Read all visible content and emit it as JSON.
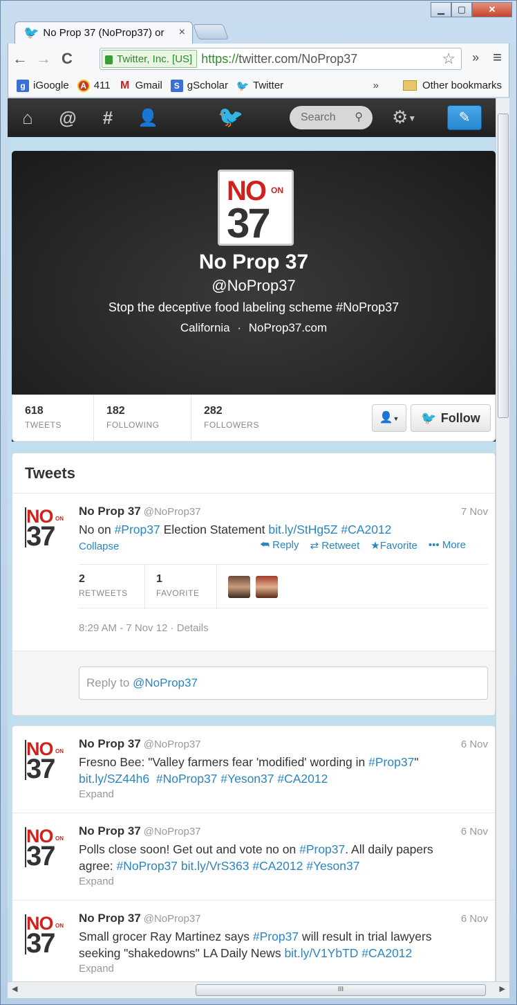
{
  "browser": {
    "tab_title": "No Prop 37 (NoProp37) or",
    "tab_close": "×",
    "window_buttons": {
      "minimize": "▁",
      "maximize": "▢",
      "close": "✕"
    },
    "nav": {
      "back": "←",
      "forward": "→",
      "reload": "C"
    },
    "ev_label": "Twitter, Inc. [US]",
    "url_scheme": "https://",
    "url_rest": "twitter.com/NoProp37",
    "overflow": "»",
    "menu": "≡",
    "bookmarks": [
      {
        "label": "iGoogle",
        "icon": "igoogle-icon",
        "glyph": "g",
        "color": "#3a6fd8"
      },
      {
        "label": "411",
        "icon": "411-icon",
        "glyph": "A",
        "color": "#c0392b"
      },
      {
        "label": "Gmail",
        "icon": "gmail-icon",
        "glyph": "M",
        "color": "#ffffff"
      },
      {
        "label": "gScholar",
        "icon": "gscholar-icon",
        "glyph": "S",
        "color": "#3a6fd8"
      },
      {
        "label": "Twitter",
        "icon": "twitter-bird-icon",
        "glyph": "🐦",
        "color": "#2aa3ef"
      }
    ],
    "bookmarks_more": "»",
    "other_bookmarks": "Other bookmarks"
  },
  "twitter": {
    "search_placeholder": "Search",
    "profile": {
      "logo_no": "NO",
      "logo_on": "ON",
      "logo_37": "37",
      "name": "No Prop 37",
      "handle": "@NoProp37",
      "bio": "Stop the deceptive food labeling scheme #NoProp37",
      "location": "California",
      "separator": "·",
      "website": "NoProp37.com"
    },
    "stats": [
      {
        "num": "618",
        "label": "TWEETS"
      },
      {
        "num": "182",
        "label": "FOLLOWING"
      },
      {
        "num": "282",
        "label": "FOLLOWERS"
      }
    ],
    "follow_label": "Follow",
    "tweets_header": "Tweets",
    "expanded_tweet": {
      "name": "No Prop 37",
      "handle": "@NoProp37",
      "time": "7 Nov",
      "text_plain_1": "No on ",
      "link_1": "#Prop37",
      "text_plain_2": " Election Statement ",
      "link_2": "bit.ly/StHg5Z",
      "link_3": "#CA2012",
      "collapse": "Collapse",
      "actions": {
        "reply": "Reply",
        "retweet": "Retweet",
        "favorite": "Favorite",
        "more": "More"
      },
      "retweets_num": "2",
      "retweets_label": "RETWEETS",
      "favorites_num": "1",
      "favorites_label": "FAVORITE",
      "timestamp": "8:29 AM - 7 Nov 12",
      "details": "Details",
      "reply_prefix": "Reply to ",
      "reply_handle": "@NoProp37"
    },
    "tweets": [
      {
        "name": "No Prop 37",
        "handle": "@NoProp37",
        "time": "6 Nov",
        "line1_plain": "Fresno Bee: \"Valley farmers fear 'modified' wording in ",
        "line1_link": "#Prop37",
        "line1_end": "\"",
        "line2": [
          "bit.ly/SZ44h6",
          "#NoProp37",
          "#Yeson37",
          "#CA2012"
        ],
        "expand": "Expand"
      },
      {
        "name": "No Prop 37",
        "handle": "@NoProp37",
        "time": "6 Nov",
        "line1_plain": "Polls close soon! Get out and vote no on ",
        "line1_link": "#Prop37",
        "line1_end": ". All daily papers",
        "line2_plain": "agree: ",
        "line2": [
          "#NoProp37",
          "bit.ly/VrS363",
          "#CA2012",
          "#Yeson37"
        ],
        "expand": "Expand"
      },
      {
        "name": "No Prop 37",
        "handle": "@NoProp37",
        "time": "6 Nov",
        "line1_plain": "Small grocer Ray Martinez says ",
        "line1_link": "#Prop37",
        "line1_end": " will result in trial lawyers",
        "line2_plain": "seeking \"shakedowns\" LA Daily News ",
        "line2": [
          "bit.ly/V1YbTD",
          "#CA2012"
        ],
        "expand": "Expand"
      }
    ]
  }
}
